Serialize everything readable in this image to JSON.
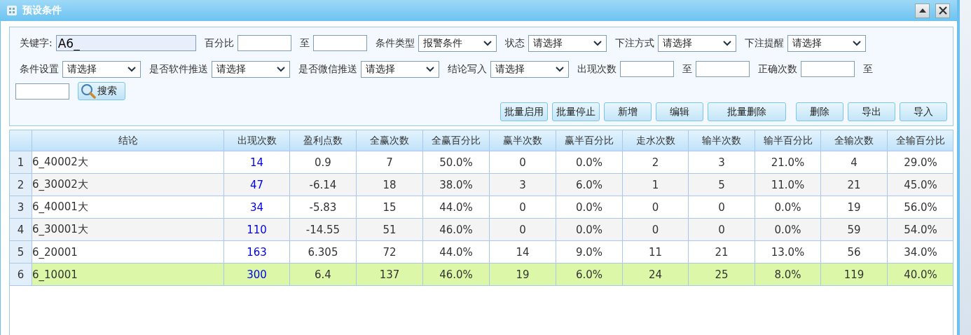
{
  "window": {
    "title": "预设条件"
  },
  "filters": [
    {
      "kind": "label",
      "text": "关键字:"
    },
    {
      "kind": "input",
      "value": "A6_"
    },
    {
      "kind": "label",
      "text": "百分比"
    },
    {
      "kind": "input"
    },
    {
      "kind": "label",
      "text": "至"
    },
    {
      "kind": "input"
    },
    {
      "kind": "label",
      "text": "条件类型"
    },
    {
      "kind": "select",
      "value": "报警条件"
    },
    {
      "kind": "label",
      "text": "状态"
    },
    {
      "kind": "select",
      "value": "请选择"
    },
    {
      "kind": "label",
      "text": "下注方式"
    },
    {
      "kind": "select",
      "value": "请选择"
    },
    {
      "kind": "label",
      "text": "下注提醒"
    },
    {
      "kind": "select",
      "value": "请选择"
    },
    {
      "kind": "break"
    },
    {
      "kind": "label",
      "text": "条件设置"
    },
    {
      "kind": "select",
      "value": "请选择"
    },
    {
      "kind": "label",
      "text": "是否软件推送"
    },
    {
      "kind": "select",
      "value": "请选择"
    },
    {
      "kind": "label",
      "text": "是否微信推送"
    },
    {
      "kind": "select",
      "value": "请选择"
    },
    {
      "kind": "label",
      "text": "结论写入"
    },
    {
      "kind": "select",
      "value": "请选择"
    },
    {
      "kind": "label",
      "text": "出现次数"
    },
    {
      "kind": "input"
    },
    {
      "kind": "label",
      "text": "至"
    },
    {
      "kind": "input"
    },
    {
      "kind": "label",
      "text": "正确次数"
    },
    {
      "kind": "input"
    },
    {
      "kind": "label",
      "text": "至"
    },
    {
      "kind": "break"
    },
    {
      "kind": "input"
    },
    {
      "kind": "search",
      "label": "搜索"
    }
  ],
  "actions": [
    {
      "label": "批量启用"
    },
    {
      "label": "批量停止"
    },
    {
      "label": "新增"
    },
    {
      "label": "编辑"
    },
    {
      "label": "批量删除"
    },
    {
      "label": "删除"
    },
    {
      "label": "导出"
    },
    {
      "label": "导入"
    }
  ],
  "table": {
    "columns": [
      "结论",
      "出现次数",
      "盈利点数",
      "全赢次数",
      "全赢百分比",
      "赢半次数",
      "赢半百分比",
      "走水次数",
      "输半次数",
      "输半百分比",
      "全输次数",
      "全输百分比"
    ],
    "rows": [
      {
        "index": "1",
        "selected": false,
        "cells": [
          "6_40002大",
          "14",
          "0.9",
          "7",
          "50.0%",
          "0",
          "0.0%",
          "2",
          "3",
          "21.0%",
          "4",
          "29.0%"
        ]
      },
      {
        "index": "2",
        "selected": false,
        "cells": [
          "6_30002大",
          "47",
          "-6.14",
          "18",
          "38.0%",
          "3",
          "6.0%",
          "1",
          "5",
          "11.0%",
          "21",
          "45.0%"
        ]
      },
      {
        "index": "3",
        "selected": false,
        "cells": [
          "6_40001大",
          "34",
          "-5.83",
          "15",
          "44.0%",
          "0",
          "0.0%",
          "0",
          "0",
          "0.0%",
          "19",
          "56.0%"
        ]
      },
      {
        "index": "4",
        "selected": false,
        "cells": [
          "6_30001大",
          "110",
          "-14.55",
          "51",
          "46.0%",
          "0",
          "0.0%",
          "0",
          "0",
          "0.0%",
          "59",
          "54.0%"
        ]
      },
      {
        "index": "5",
        "selected": false,
        "cells": [
          "6_20001",
          "163",
          "6.305",
          "72",
          "44.0%",
          "14",
          "9.0%",
          "11",
          "21",
          "13.0%",
          "56",
          "34.0%"
        ]
      },
      {
        "index": "6",
        "selected": true,
        "cells": [
          "6_10001",
          "300",
          "6.4",
          "137",
          "46.0%",
          "19",
          "6.0%",
          "24",
          "25",
          "8.0%",
          "119",
          "40.0%"
        ]
      }
    ]
  }
}
